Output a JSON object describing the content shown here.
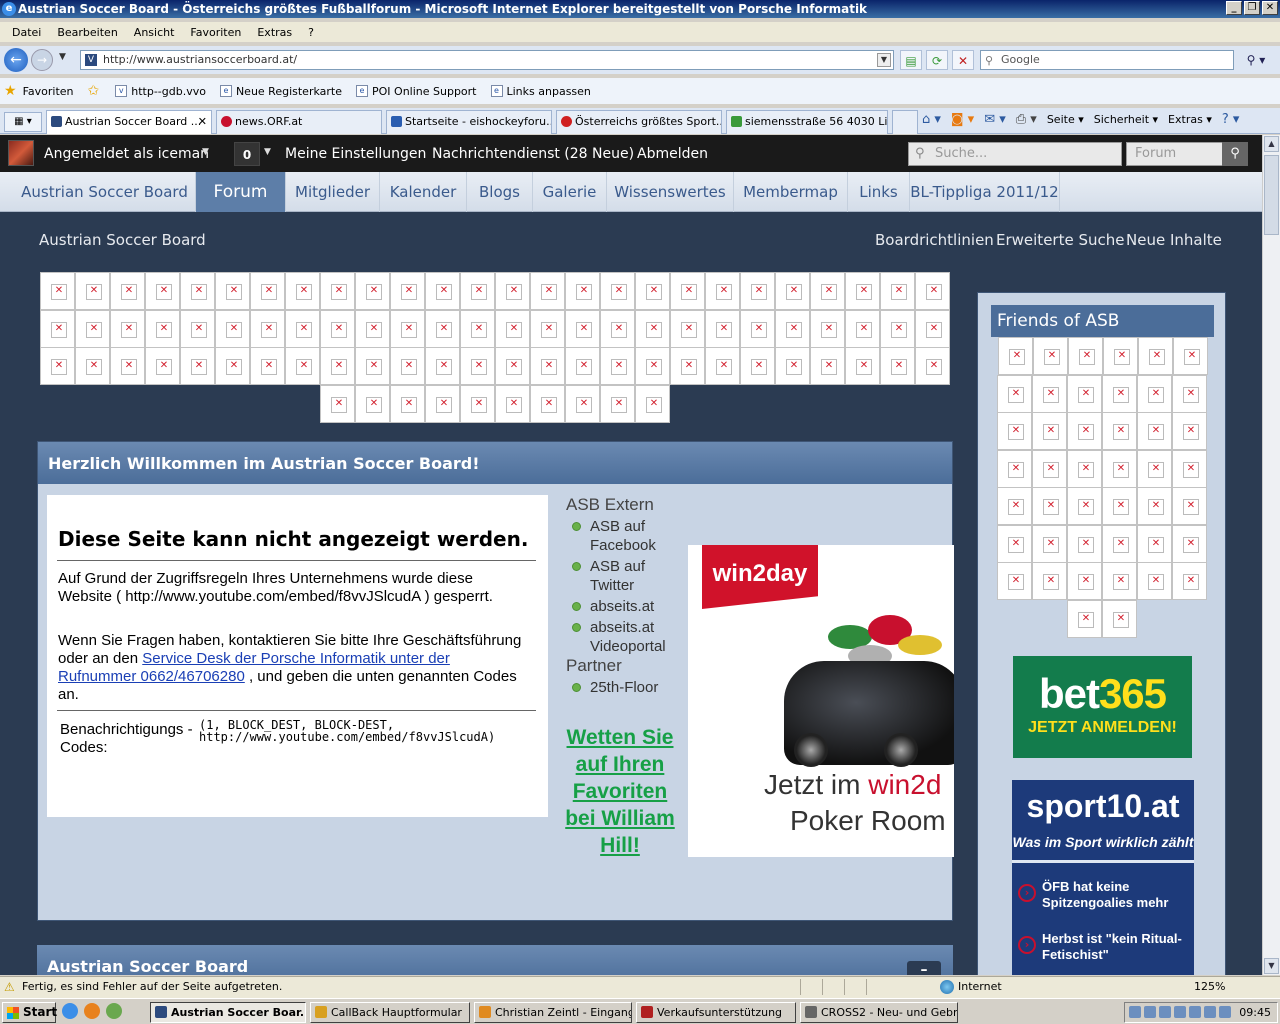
{
  "window": {
    "title": "Austrian Soccer Board - Österreichs größtes Fußballforum - Microsoft Internet Explorer bereitgestellt von Porsche Informatik"
  },
  "menu": [
    "Datei",
    "Bearbeiten",
    "Ansicht",
    "Favoriten",
    "Extras",
    "?"
  ],
  "address": {
    "url": "http://www.austriansoccerboard.at/",
    "search_placeholder": "Google"
  },
  "favorites_bar": {
    "label": "Favoriten",
    "items": [
      "http--gdb.vvo",
      "Neue Registerkarte",
      "POI Online Support",
      "Links anpassen"
    ]
  },
  "tabs": [
    {
      "label": "Austrian Soccer Board ...",
      "color": "#2c4a7e"
    },
    {
      "label": "news.ORF.at",
      "color": "#c8102e"
    },
    {
      "label": "Startseite - eishockeyforu...",
      "color": "#2a5db0"
    },
    {
      "label": "Österreichs größtes Sport...",
      "color": "#d02020"
    },
    {
      "label": "siemensstraße 56 4030 Lin...",
      "color": "#3a9a3a"
    }
  ],
  "commandbar": {
    "page": "Seite",
    "security": "Sicherheit",
    "tools": "Extras"
  },
  "userbar": {
    "logged_in": "Angemeldet als iceman",
    "notif_count": "0",
    "settings": "Meine Einstellungen",
    "messages": "Nachrichtendienst (28 Neue)",
    "logout": "Abmelden",
    "search_placeholder": "Suche...",
    "search_scope": "Forum"
  },
  "nav": [
    "Austrian Soccer Board",
    "Forum",
    "Mitglieder",
    "Kalender",
    "Blogs",
    "Galerie",
    "Wissenswertes",
    "Membermap",
    "Links",
    "BL-Tippliga 2011/12"
  ],
  "breadcrumb": "Austrian Soccer Board",
  "toplinks": [
    "Boardrichtlinien",
    "Erweiterte Suche",
    "Neue Inhalte"
  ],
  "welcome": {
    "title": "Herzlich Willkommen im Austrian Soccer Board!",
    "error_title": "Diese Seite kann nicht angezeigt werden.",
    "error_p1": "Auf Grund der Zugriffsregeln Ihres Unternehmens wurde diese Website ( http://www.youtube.com/embed/f8vvJSlcudA ) gesperrt.",
    "error_p2_pre": "Wenn Sie Fragen haben, kontaktieren Sie bitte Ihre Geschäftsführung oder an den ",
    "error_p2_link": "Service Desk der Porsche Informatik unter der Rufnummer 0662/46706280",
    "error_p2_post": " , und geben die unten genannten Codes an.",
    "codes_label": "Benachrichtigungs -Codes:",
    "codes_value": "(1, BLOCK_DEST, BLOCK-DEST,\nhttp://www.youtube.com/embed/f8vvJSlcudA)"
  },
  "extern": {
    "heading": "ASB Extern",
    "items": [
      "ASB auf Facebook",
      "ASB auf Twitter",
      "abseits.at",
      "abseits.at Videoportal"
    ],
    "partner_heading": "Partner",
    "partner_items": [
      "25th-Floor"
    ],
    "wetten": "Wetten Sie auf Ihren Favoriten bei William Hill!"
  },
  "win2day": {
    "logo": "win2day",
    "line1_a": "Jetzt im ",
    "line1_b": "win2d",
    "line2": "Poker Room"
  },
  "section2": {
    "title": "Austrian Soccer Board",
    "collapse": "–"
  },
  "sidebar": {
    "title": "Friends of ASB",
    "bet365_a": "bet",
    "bet365_b": "365",
    "bet365_cta": "JETZT ANMELDEN!",
    "sport10_logo": "sport10.at",
    "sport10_tag": "Was im Sport wirklich zählt",
    "news": [
      "ÖFB hat keine Spitzengoalies mehr",
      "Herbst ist \"kein Ritual-Fetischist\""
    ]
  },
  "status": {
    "text": "Fertig, es sind Fehler auf der Seite aufgetreten.",
    "zone": "Internet",
    "zoom": "125%"
  },
  "taskbar": {
    "start": "Start",
    "items": [
      {
        "label": "Austrian Soccer Boar...",
        "active": true,
        "color": "#2c4a7e"
      },
      {
        "label": "CallBack Hauptformular",
        "active": false,
        "color": "#d8a020"
      },
      {
        "label": "Christian Zeintl - Eingang...",
        "active": false,
        "color": "#e08a20"
      },
      {
        "label": "Verkaufsunterstützung",
        "active": false,
        "color": "#b02020"
      },
      {
        "label": "CROSS2 - Neu- und Gebr...",
        "active": false,
        "color": "#666666"
      }
    ],
    "clock": "09:45"
  }
}
